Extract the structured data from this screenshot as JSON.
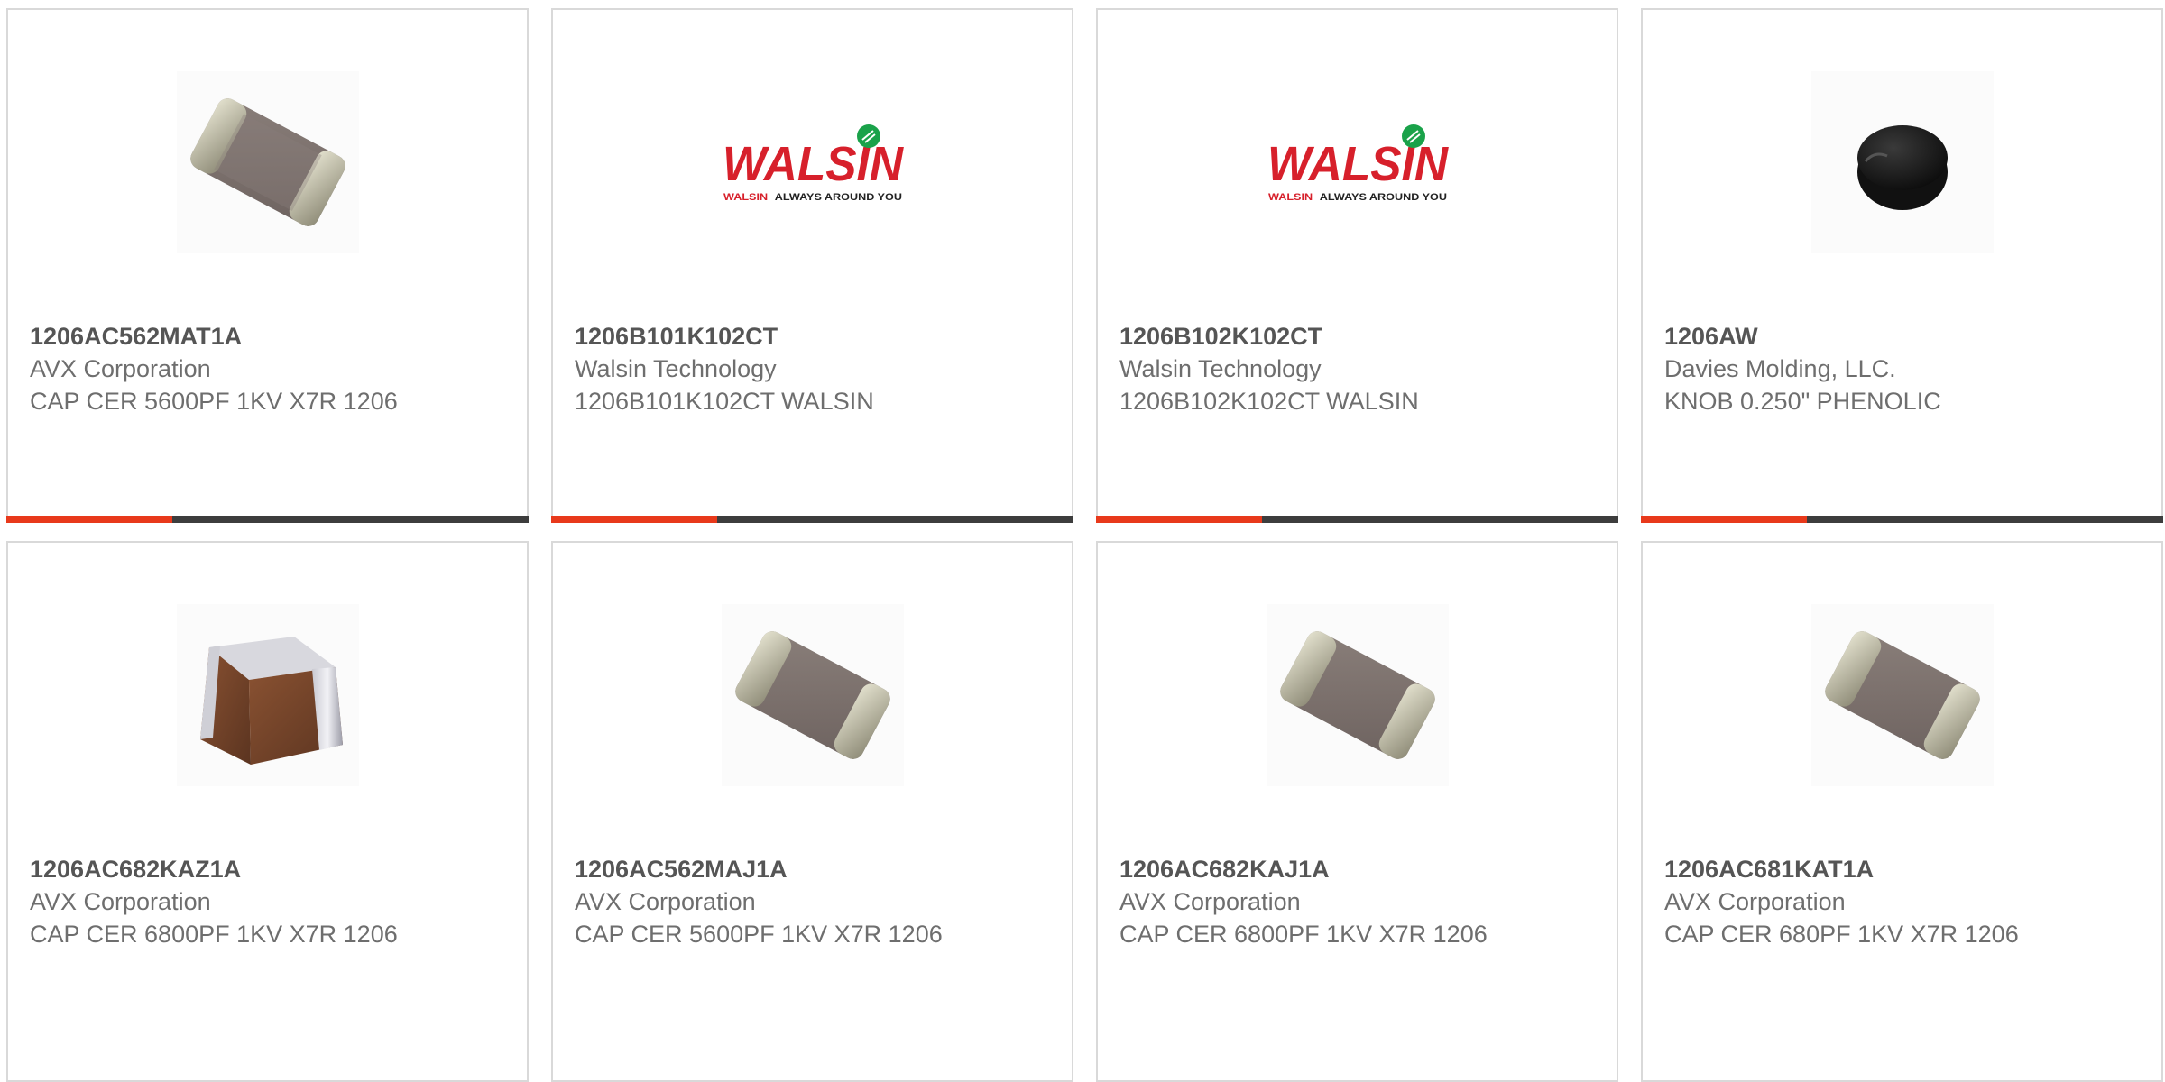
{
  "products": [
    {
      "part": "1206AC562MAT1A",
      "manufacturer": "AVX Corporation",
      "description": "CAP CER 5600PF 1KV X7R 1206",
      "image": "mlcc-capacitor-icon"
    },
    {
      "part": "1206B101K102CT",
      "manufacturer": "Walsin Technology",
      "description": "1206B101K102CT WALSIN",
      "image": "walsin-logo"
    },
    {
      "part": "1206B102K102CT",
      "manufacturer": "Walsin Technology",
      "description": "1206B102K102CT WALSIN",
      "image": "walsin-logo"
    },
    {
      "part": "1206AW",
      "manufacturer": "Davies Molding, LLC.",
      "description": "KNOB 0.250\" PHENOLIC",
      "image": "black-knob-icon"
    },
    {
      "part": "1206AC682KAZ1A",
      "manufacturer": "AVX Corporation",
      "description": "CAP CER 6800PF 1KV X7R 1206",
      "image": "brown-capacitor-icon"
    },
    {
      "part": "1206AC562MAJ1A",
      "manufacturer": "AVX Corporation",
      "description": "CAP CER 5600PF 1KV X7R 1206",
      "image": "mlcc-capacitor-icon"
    },
    {
      "part": "1206AC682KAJ1A",
      "manufacturer": "AVX Corporation",
      "description": "CAP CER 6800PF 1KV X7R 1206",
      "image": "mlcc-capacitor-icon"
    },
    {
      "part": "1206AC681KAT1A",
      "manufacturer": "AVX Corporation",
      "description": "CAP CER 680PF 1KV X7R 1206",
      "image": "mlcc-capacitor-icon"
    }
  ],
  "walsin_logo": {
    "wordmark": "WALSIN",
    "tagline_brand": "WALSIN",
    "tagline": "ALWAYS AROUND YOU"
  },
  "colors": {
    "accent": "#e8391b",
    "bar_dark": "#3d3d3d",
    "card_border": "#d9d9d9",
    "walsin_red": "#d7202b",
    "walsin_green": "#1aa24a"
  }
}
